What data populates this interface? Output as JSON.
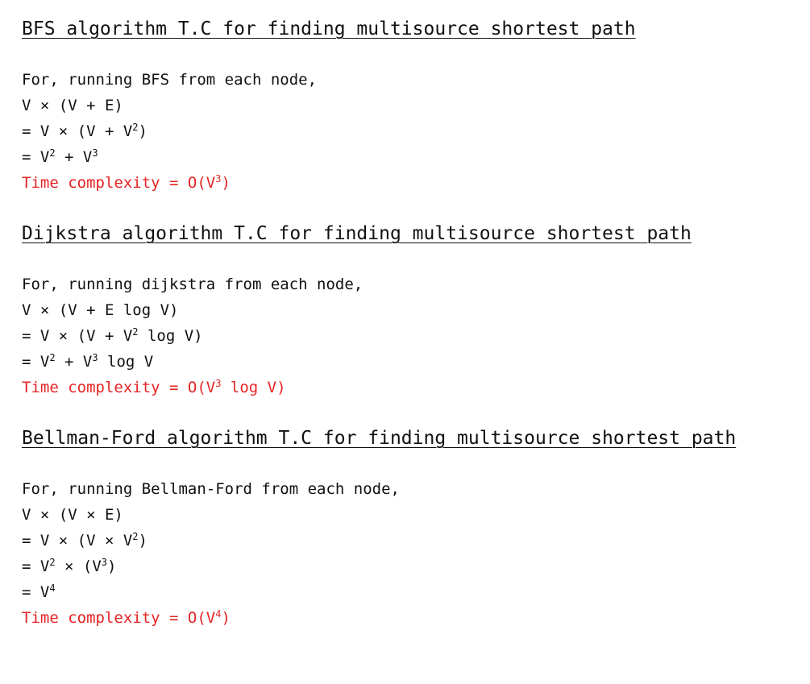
{
  "sections": [
    {
      "heading": "BFS algorithm T.C for finding multisource shortest path",
      "intro": "For, running BFS from each node,",
      "steps": [
        {
          "text": "V × (V + E)",
          "sup": "",
          "tail": "",
          "sup2": "",
          "tail2": ""
        },
        {
          "text": "= V × (V + V",
          "sup": "2",
          "tail": ")",
          "sup2": "",
          "tail2": ""
        },
        {
          "text": "= V",
          "sup": "2",
          "tail": " + V",
          "sup2": "3",
          "tail2": ""
        }
      ],
      "result": {
        "prefix": "Time complexity = O(V",
        "sup": "3",
        "suffix": ")"
      }
    },
    {
      "heading": "Dijkstra algorithm T.C for finding multisource shortest path",
      "intro": "For, running dijkstra from each node,",
      "steps": [
        {
          "text": "V × (V + E log V)",
          "sup": "",
          "tail": "",
          "sup2": "",
          "tail2": ""
        },
        {
          "text": "= V × (V + V",
          "sup": "2",
          "tail": " log V)",
          "sup2": "",
          "tail2": ""
        },
        {
          "text": "= V",
          "sup": "2",
          "tail": " + V",
          "sup2": "3",
          "tail2": " log V"
        }
      ],
      "result": {
        "prefix": "Time complexity = O(V",
        "sup": "3",
        "suffix": " log V)"
      }
    },
    {
      "heading": "Bellman-Ford algorithm T.C for finding multisource shortest path",
      "intro": "For, running Bellman-Ford from each node,",
      "steps": [
        {
          "text": "V × (V × E)",
          "sup": "",
          "tail": "",
          "sup2": "",
          "tail2": ""
        },
        {
          "text": "= V × (V × V",
          "sup": "2",
          "tail": ")",
          "sup2": "",
          "tail2": ""
        },
        {
          "text": "= V",
          "sup": "2",
          "tail": " × (V",
          "sup2": "3",
          "tail2": ")"
        },
        {
          "text": "= V",
          "sup": "4",
          "tail": "",
          "sup2": "",
          "tail2": ""
        }
      ],
      "result": {
        "prefix": "Time complexity = O(V",
        "sup": "4",
        "suffix": ")"
      }
    }
  ]
}
